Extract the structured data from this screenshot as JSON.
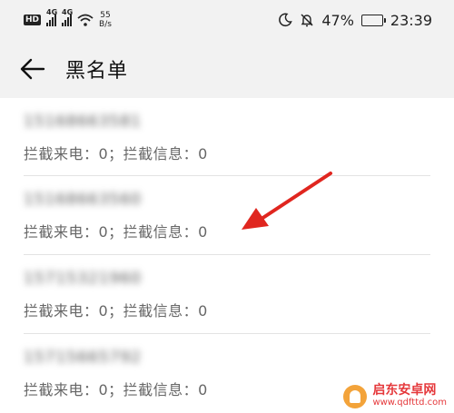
{
  "status_bar": {
    "hd_badge": "HD",
    "network_1": "4G",
    "network_2": "4G",
    "speed_value": "55",
    "speed_unit": "B/s",
    "battery_percent": "47%",
    "battery_level": 0.47,
    "time": "23:39",
    "icons": [
      "hd-icon",
      "signal-icon",
      "signal-icon",
      "wifi-icon",
      "moon-icon",
      "mute-bell-icon",
      "battery-icon"
    ]
  },
  "app_bar": {
    "back_icon": "arrow-left-icon",
    "title": "黑名单"
  },
  "blacklist": {
    "items": [
      {
        "number": "15168663581",
        "stats": "拦截来电：0；拦截信息：0"
      },
      {
        "number": "15168663560",
        "stats": "拦截来电：0；拦截信息：0"
      },
      {
        "number": "15715321960",
        "stats": "拦截来电：0；拦截信息：0"
      },
      {
        "number": "15715665792",
        "stats": "拦截来电：0；拦截信息：0"
      }
    ]
  },
  "watermark": {
    "name": "启东安卓网",
    "url": "www.qdfttd.com"
  },
  "colors": {
    "background": "#f2f2f2",
    "list_background": "#ffffff",
    "annotation_arrow": "#e0261f",
    "watermark": "#e5383b"
  }
}
